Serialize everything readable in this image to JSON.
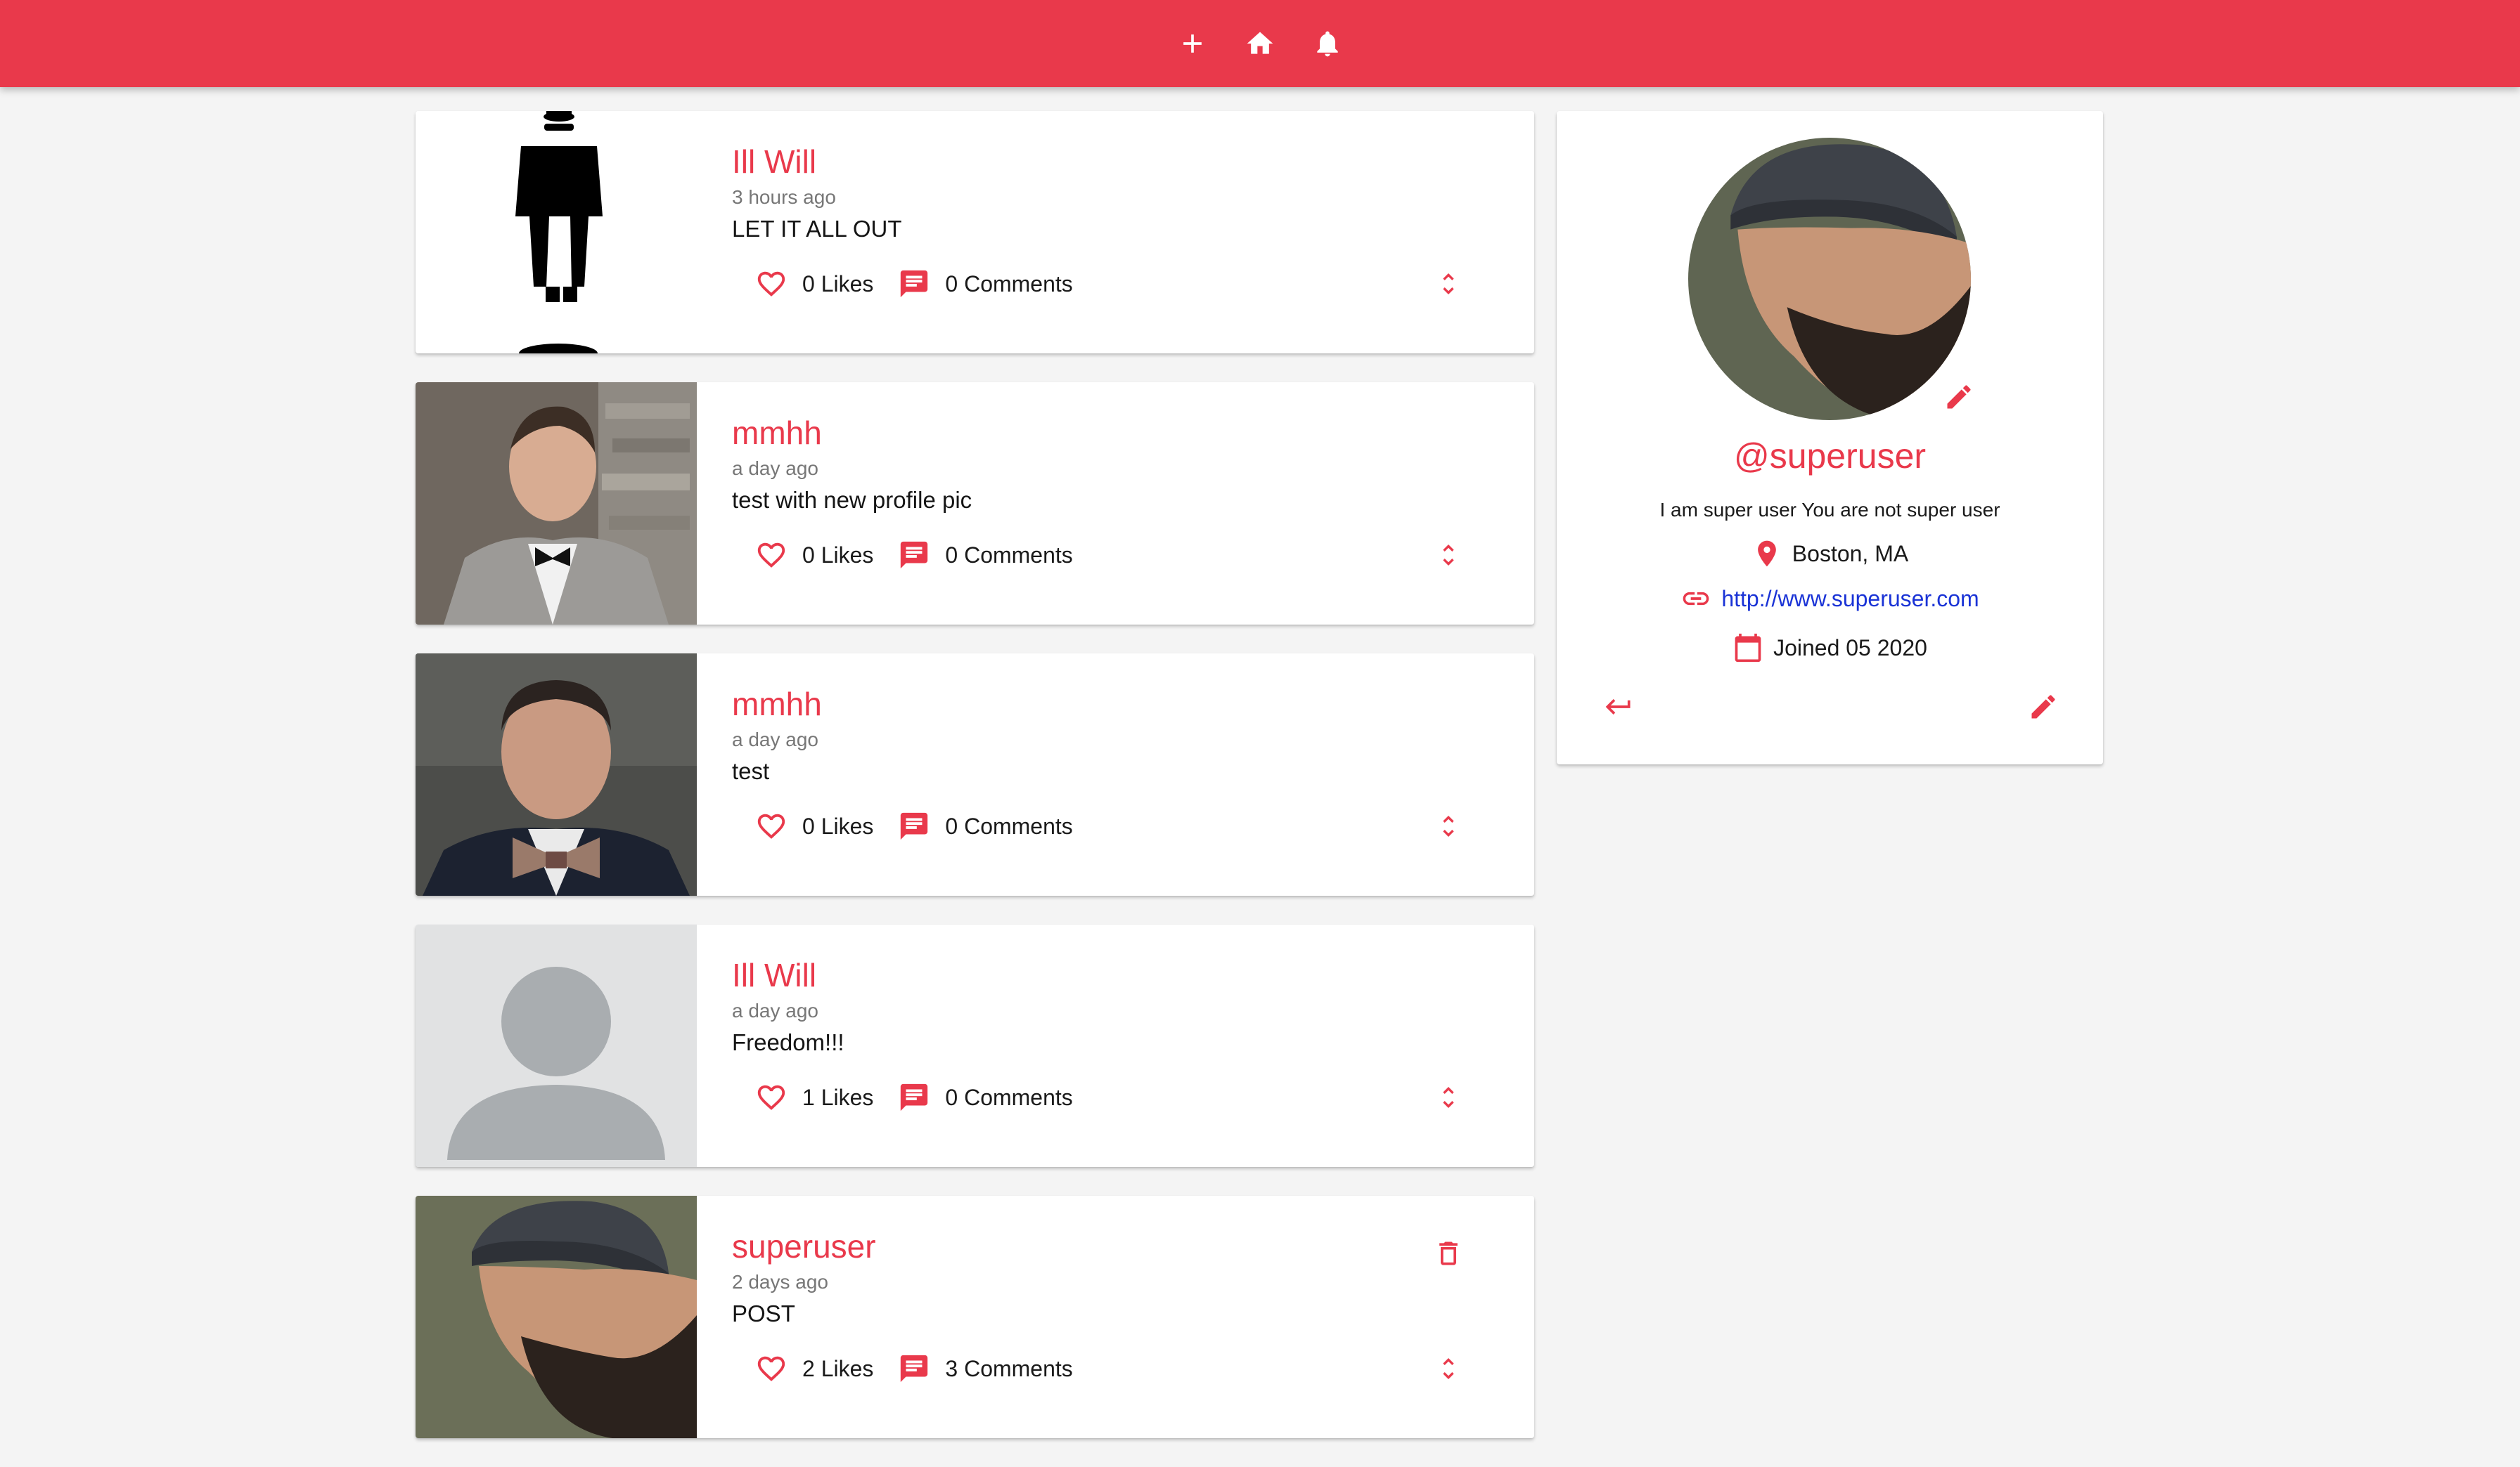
{
  "nav": {
    "icons": [
      "plus-icon",
      "home-icon",
      "bell-icon"
    ]
  },
  "colors": {
    "primary": "#e9394b",
    "link": "#1a33d6",
    "background": "#f4f4f4"
  },
  "posts": [
    {
      "author": "Ill Will",
      "time": "3 hours ago",
      "body": "LET IT ALL OUT",
      "likes": "0 Likes",
      "comments": "0 Comments",
      "thumb": "spy-silhouette"
    },
    {
      "author": "mmhh",
      "time": "a day ago",
      "body": "test with new profile pic",
      "likes": "0 Likes",
      "comments": "0 Comments",
      "thumb": "man-in-bowtie-gray-suit"
    },
    {
      "author": "mmhh",
      "time": "a day ago",
      "body": "test",
      "likes": "0 Likes",
      "comments": "0 Comments",
      "thumb": "man-in-bowtie-navy-suit"
    },
    {
      "author": "Ill Will",
      "time": "a day ago",
      "body": "Freedom!!!",
      "likes": "1 Likes",
      "comments": "0 Comments",
      "thumb": "default-avatar"
    },
    {
      "author": "superuser",
      "time": "2 days ago",
      "body": "POST",
      "likes": "2 Likes",
      "comments": "3 Comments",
      "thumb": "bearded-man-beanie"
    }
  ],
  "profile": {
    "handle": "@superuser",
    "bio": "I am super user You are not super user",
    "location": "Boston, MA",
    "website": "http://www.superuser.com",
    "joined": "Joined 05 2020"
  }
}
